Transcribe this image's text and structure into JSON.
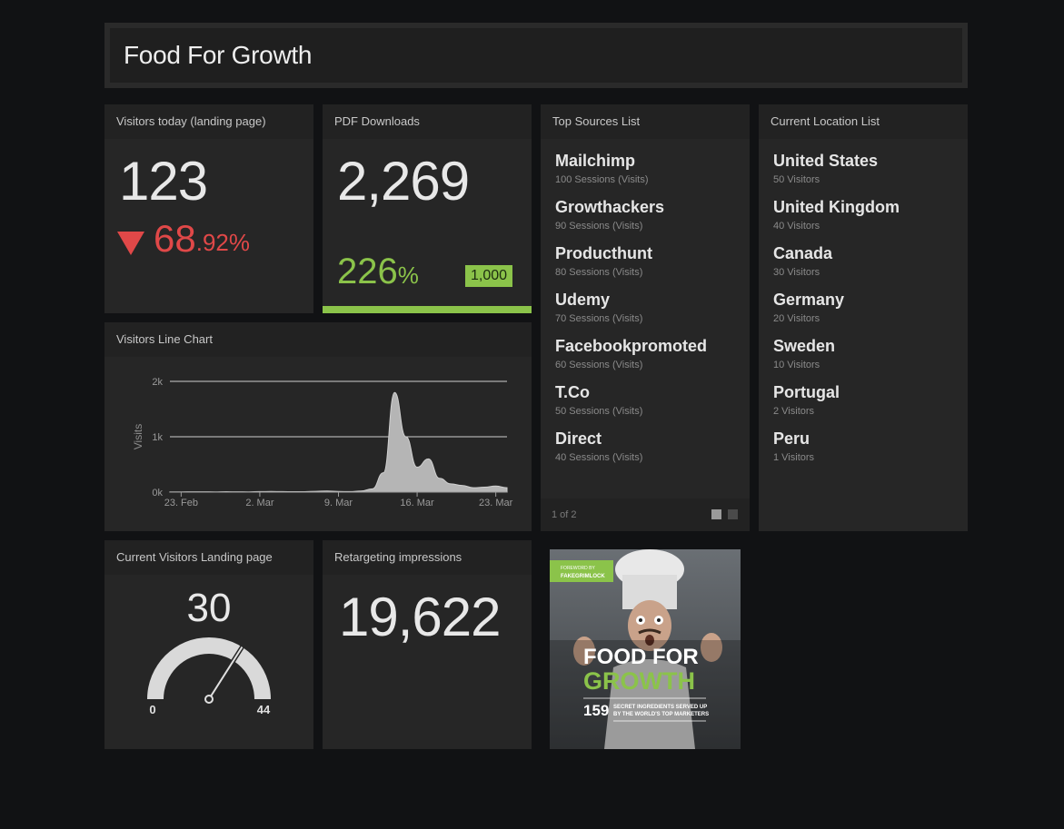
{
  "header": {
    "title": "Food For Growth"
  },
  "visitors_today": {
    "title": "Visitors today (landing page)",
    "value": "123",
    "change_int": "68",
    "change_dec": ".92%"
  },
  "pdf_downloads": {
    "title": "PDF Downloads",
    "value": "2,269",
    "pct": "226",
    "pct_sign": "%",
    "goal": "1,000",
    "progress": 1.0
  },
  "top_sources": {
    "title": "Top Sources List",
    "items": [
      {
        "name": "Mailchimp",
        "sub": "100 Sessions (Visits)"
      },
      {
        "name": "Growthackers",
        "sub": "90 Sessions (Visits)"
      },
      {
        "name": "Producthunt",
        "sub": "80 Sessions (Visits)"
      },
      {
        "name": "Udemy",
        "sub": "70 Sessions (Visits)"
      },
      {
        "name": "Facebookpromoted",
        "sub": "60 Sessions (Visits)"
      },
      {
        "name": "T.Co",
        "sub": "50 Sessions (Visits)"
      },
      {
        "name": "Direct",
        "sub": "40 Sessions (Visits)"
      }
    ],
    "pager": "1 of 2"
  },
  "locations": {
    "title": "Current Location List",
    "items": [
      {
        "name": "United States",
        "sub": "50 Visitors"
      },
      {
        "name": "United Kingdom",
        "sub": "40 Visitors"
      },
      {
        "name": "Canada",
        "sub": "30 Visitors"
      },
      {
        "name": "Germany",
        "sub": "20 Visitors"
      },
      {
        "name": "Sweden",
        "sub": "10 Visitors"
      },
      {
        "name": "Portugal",
        "sub": "2 Visitors"
      },
      {
        "name": "Peru",
        "sub": "1 Visitors"
      }
    ]
  },
  "line_chart": {
    "title": "Visitors Line Chart"
  },
  "chart_data": {
    "type": "area",
    "title": "",
    "xlabel": "",
    "ylabel": "Visits",
    "ylim": [
      0,
      2000
    ],
    "yticks": [
      "0k",
      "1k",
      "2k"
    ],
    "xticks": [
      "23. Feb",
      "2. Mar",
      "9. Mar",
      "16. Mar",
      "23. Mar"
    ],
    "grid": true,
    "x": [
      "2015-02-22",
      "2015-02-23",
      "2015-02-24",
      "2015-02-25",
      "2015-02-26",
      "2015-02-27",
      "2015-02-28",
      "2015-03-01",
      "2015-03-02",
      "2015-03-03",
      "2015-03-04",
      "2015-03-05",
      "2015-03-06",
      "2015-03-07",
      "2015-03-08",
      "2015-03-09",
      "2015-03-10",
      "2015-03-11",
      "2015-03-12",
      "2015-03-13",
      "2015-03-14",
      "2015-03-15",
      "2015-03-16",
      "2015-03-17",
      "2015-03-18",
      "2015-03-19",
      "2015-03-20",
      "2015-03-21",
      "2015-03-22",
      "2015-03-23",
      "2015-03-24"
    ],
    "series": [
      {
        "values": [
          5,
          5,
          6,
          6,
          5,
          8,
          6,
          5,
          10,
          12,
          10,
          8,
          8,
          15,
          20,
          12,
          10,
          20,
          60,
          350,
          1800,
          1000,
          450,
          600,
          250,
          150,
          120,
          80,
          90,
          110,
          80
        ]
      }
    ]
  },
  "gauge": {
    "title": "Current Visitors Landing page",
    "value": "30",
    "min": "0",
    "max": "44",
    "fraction": 0.68
  },
  "retargeting": {
    "title": "Retargeting impressions",
    "value": "19,622"
  },
  "book": {
    "foreword_label": "FOREWORD BY",
    "foreword_name": "FAKEGRIMLOCK",
    "title_line1": "FOOD FOR",
    "title_line2": "GROWTH",
    "number": "159",
    "tagline1": "SECRET INGREDIENTS SERVED UP",
    "tagline2": "BY THE WORLD'S TOP MARKETERS",
    "accent": "#8bc34a"
  },
  "colors": {
    "background": "#111214",
    "panel": "#262626",
    "positive": "#8bc34a",
    "negative": "#e04848"
  }
}
